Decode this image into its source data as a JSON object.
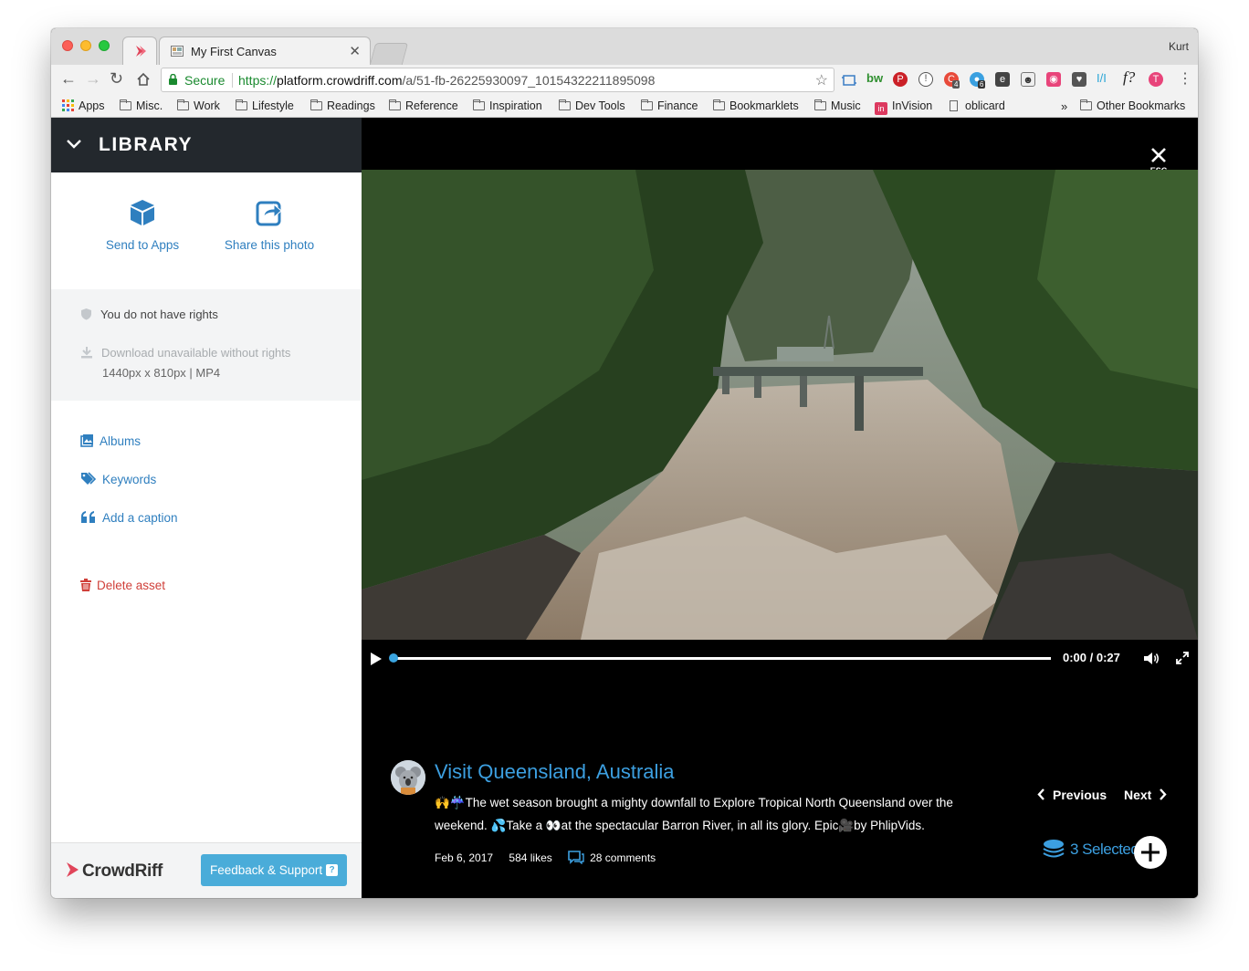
{
  "browser": {
    "tab_title": "My First Canvas",
    "profile_name": "Kurt",
    "secure_label": "Secure",
    "url_scheme": "https://",
    "url_host": "platform.crowdriff.com",
    "url_path": "/a/51-fb-26225930097_10154322211895098",
    "extensions": [
      "screen-capture-icon",
      "bw-icon",
      "pinterest-icon",
      "info-icon",
      "notification-icon",
      "badge-icon",
      "evernote-icon",
      "ghost-icon",
      "camera-icon",
      "pocket-icon",
      "vim-icon",
      "font-icon",
      "profile-icon",
      "menu-icon"
    ],
    "extension_badges": {
      "notif": "4",
      "badge": "6"
    },
    "bookmarks": [
      {
        "label": "Apps"
      },
      {
        "label": "Misc."
      },
      {
        "label": "Work"
      },
      {
        "label": "Lifestyle"
      },
      {
        "label": "Readings"
      },
      {
        "label": "Reference"
      },
      {
        "label": "Inspiration"
      },
      {
        "label": "Dev Tools"
      },
      {
        "label": "Finance"
      },
      {
        "label": "Bookmarklets"
      },
      {
        "label": "Music"
      },
      {
        "label": "InVision"
      },
      {
        "label": "oblicard"
      },
      {
        "label": "Other Bookmarks"
      }
    ],
    "overflow": "»"
  },
  "sidebar": {
    "header_title": "LIBRARY",
    "actions": [
      {
        "label": "Send to Apps"
      },
      {
        "label": "Share this photo"
      }
    ],
    "rights": {
      "status": "You do not have rights",
      "download": "Download unavailable without rights",
      "dimensions": "1440px x 810px | MP4"
    },
    "links": [
      {
        "label": "Albums"
      },
      {
        "label": "Keywords"
      },
      {
        "label": "Add a caption"
      }
    ],
    "delete_label": "Delete asset",
    "brand": "CrowdRiff",
    "feedback_label": "Feedback & Support"
  },
  "viewer": {
    "close_label": "ESC",
    "player": {
      "time": "0:00 / 0:27",
      "progress": 0
    },
    "source_title": "Visit Queensland, Australia",
    "caption_line1": "🙌☔The wet season brought a mighty downfall to Explore Tropical North Queensland over the",
    "caption_line2": "weekend. 💦Take a 👀at the spectacular Barron River, in all its glory. Epic🎥by PhlipVids.",
    "date": "Feb 6, 2017",
    "likes": "584 likes",
    "comments": "28 comments",
    "prev_label": "Previous",
    "next_label": "Next",
    "selected_label": "3 Selected"
  },
  "colors": {
    "accent": "#3c9fe0",
    "link": "#2f7fbf",
    "danger": "#d0403a",
    "header_bg": "#23282d",
    "feedback_bg": "#4aacd9"
  }
}
